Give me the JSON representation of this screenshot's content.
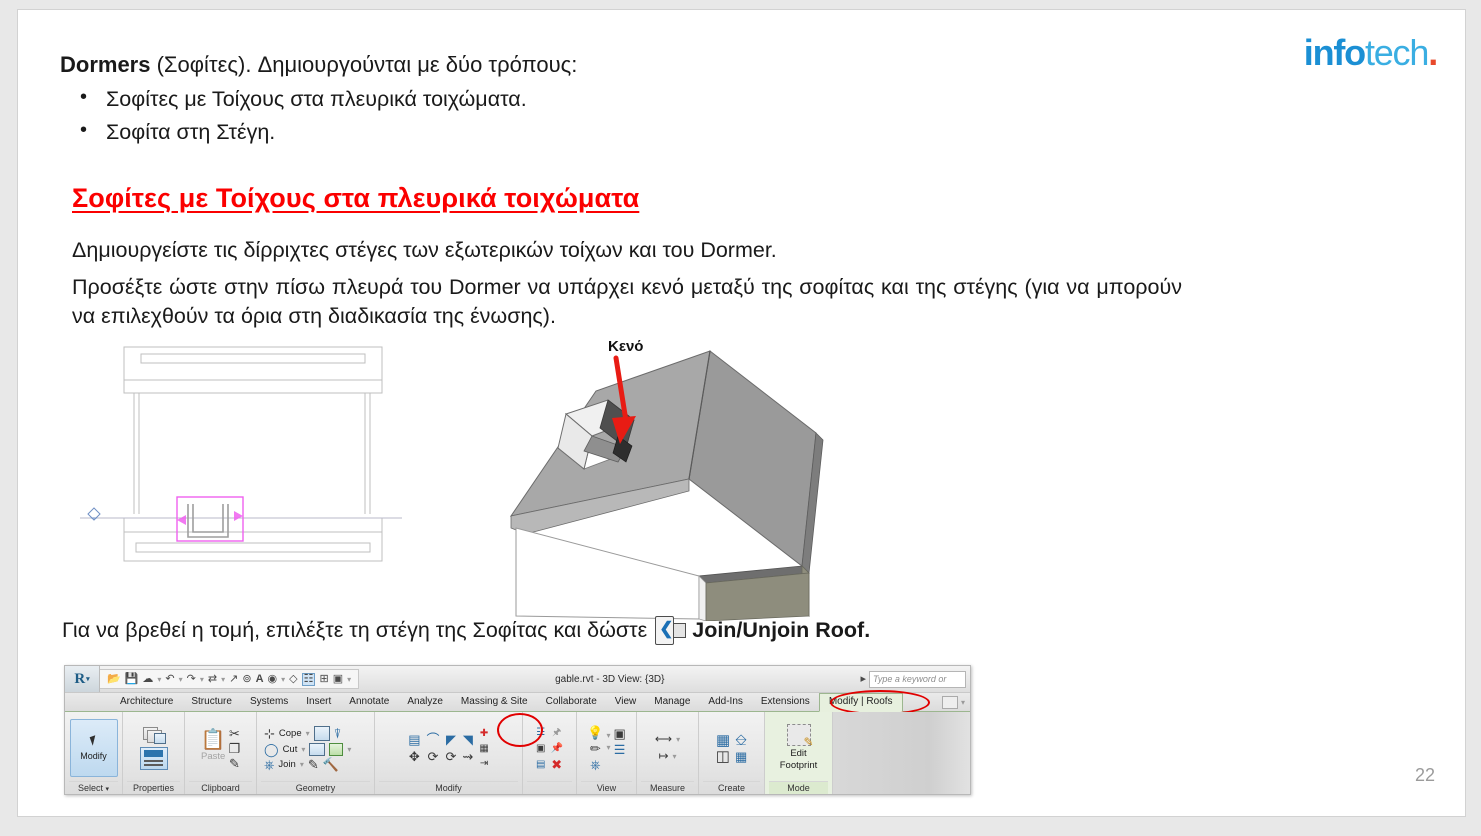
{
  "slide": {
    "page_number": "22",
    "logo": {
      "part1": "info",
      "part2": "tech",
      "dot": "."
    }
  },
  "content": {
    "lead_bold": "Dormers",
    "lead_rest": " (Σοφίτες). Δημιουργούνται με δύο τρόπους:",
    "bullets": [
      "Σοφίτες με Τοίχους στα πλευρικά τοιχώματα.",
      "Σοφίτα στη Στέγη."
    ],
    "heading": "Σοφίτες με Τοίχους στα πλευρικά τοιχώματα",
    "para1": "Δημιουργείστε τις δίρριχτες στέγες των εξωτερικών τοίχων και του Dormer.",
    "para2": "Προσέξτε ώστε στην πίσω πλευρά του Dormer να υπάρχει κενό μεταξύ της σοφίτας και της στέγης (για να μπορούν να επιλεχθούν τα όρια στη διαδικασία της ένωσης).",
    "join_line_prefix": "Για να βρεθεί η τομή, επιλέξτε τη στέγη της Σοφίτας και δώστε",
    "join_command": "Join/Unjoin Roof.",
    "annotation_keno": "Κενό"
  },
  "colors": {
    "heading_red": "#fb0000",
    "logo_blue": "#1b8fd4",
    "logo_cyan": "#3aaee2",
    "logo_dot": "#e8492b",
    "annotation_arrow": "#e81c14",
    "plan_magenta": "#f060f0"
  },
  "ribbon": {
    "app_letter": "R",
    "document_title": "gable.rvt - 3D View: {3D}",
    "search_placeholder": "Type a keyword or",
    "quick_access": [
      "open-icon",
      "save-icon",
      "sync-icon",
      "undo-icon",
      "redo-icon",
      "measure-icon",
      "align-icon",
      "dimension-icon",
      "text-icon",
      "view-icon",
      "default-3d-icon",
      "section-box-icon",
      "close-hidden-icon",
      "tile-windows-icon"
    ],
    "tabs": [
      "Architecture",
      "Structure",
      "Systems",
      "Insert",
      "Annotate",
      "Analyze",
      "Massing & Site",
      "Collaborate",
      "View",
      "Manage",
      "Add-Ins",
      "Extensions"
    ],
    "contextual_tab": "Modify | Roofs",
    "panels": [
      {
        "label": "Select",
        "big_button": "Modify"
      },
      {
        "label": "Properties"
      },
      {
        "label": "Clipboard",
        "items": [
          "Paste",
          "Cut",
          "Copy",
          "Match Type"
        ]
      },
      {
        "label": "Geometry",
        "items": [
          "Cope",
          "Cut",
          "Join"
        ]
      },
      {
        "label": "Modify"
      },
      {
        "label": "View"
      },
      {
        "label": "Measure"
      },
      {
        "label": "Create"
      },
      {
        "label": "Mode",
        "big_button_l1": "Edit",
        "big_button_l2": "Footprint"
      }
    ]
  }
}
